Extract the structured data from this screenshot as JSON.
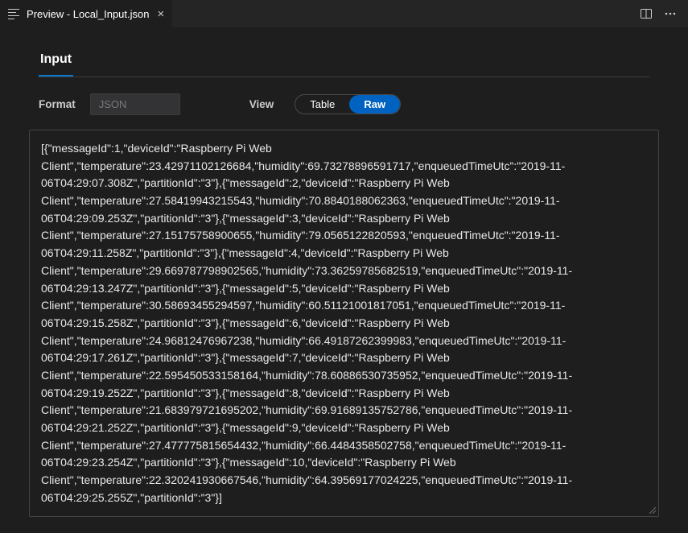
{
  "window": {
    "tab_title": "Preview - Local_Input.json"
  },
  "page": {
    "heading": "Input",
    "format_label": "Format",
    "format_value": "JSON",
    "view_label": "View",
    "view_options": {
      "table": "Table",
      "raw": "Raw"
    },
    "view_selected": "raw"
  },
  "raw_content": "[{\"messageId\":1,\"deviceId\":\"Raspberry Pi Web Client\",\"temperature\":23.42971102126684,\"humidity\":69.73278896591717,\"enqueuedTimeUtc\":\"2019-11-06T04:29:07.308Z\",\"partitionId\":\"3\"},{\"messageId\":2,\"deviceId\":\"Raspberry Pi Web Client\",\"temperature\":27.58419943215543,\"humidity\":70.8840188062363,\"enqueuedTimeUtc\":\"2019-11-06T04:29:09.253Z\",\"partitionId\":\"3\"},{\"messageId\":3,\"deviceId\":\"Raspberry Pi Web Client\",\"temperature\":27.15175758900655,\"humidity\":79.0565122820593,\"enqueuedTimeUtc\":\"2019-11-06T04:29:11.258Z\",\"partitionId\":\"3\"},{\"messageId\":4,\"deviceId\":\"Raspberry Pi Web Client\",\"temperature\":29.669787798902565,\"humidity\":73.36259785682519,\"enqueuedTimeUtc\":\"2019-11-06T04:29:13.247Z\",\"partitionId\":\"3\"},{\"messageId\":5,\"deviceId\":\"Raspberry Pi Web Client\",\"temperature\":30.58693455294597,\"humidity\":60.51121001817051,\"enqueuedTimeUtc\":\"2019-11-06T04:29:15.258Z\",\"partitionId\":\"3\"},{\"messageId\":6,\"deviceId\":\"Raspberry Pi Web Client\",\"temperature\":24.96812476967238,\"humidity\":66.49187262399983,\"enqueuedTimeUtc\":\"2019-11-06T04:29:17.261Z\",\"partitionId\":\"3\"},{\"messageId\":7,\"deviceId\":\"Raspberry Pi Web Client\",\"temperature\":22.595450533158164,\"humidity\":78.60886530735952,\"enqueuedTimeUtc\":\"2019-11-06T04:29:19.252Z\",\"partitionId\":\"3\"},{\"messageId\":8,\"deviceId\":\"Raspberry Pi Web Client\",\"temperature\":21.683979721695202,\"humidity\":69.91689135752786,\"enqueuedTimeUtc\":\"2019-11-06T04:29:21.252Z\",\"partitionId\":\"3\"},{\"messageId\":9,\"deviceId\":\"Raspberry Pi Web Client\",\"temperature\":27.477775815654432,\"humidity\":66.4484358502758,\"enqueuedTimeUtc\":\"2019-11-06T04:29:23.254Z\",\"partitionId\":\"3\"},{\"messageId\":10,\"deviceId\":\"Raspberry Pi Web Client\",\"temperature\":22.320241930667546,\"humidity\":64.39569177024225,\"enqueuedTimeUtc\":\"2019-11-06T04:29:25.255Z\",\"partitionId\":\"3\"}]"
}
